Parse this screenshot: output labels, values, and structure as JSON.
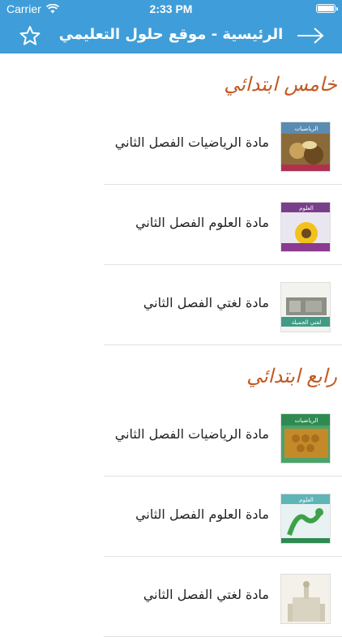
{
  "status_bar": {
    "carrier": "Carrier",
    "time": "2:33 PM"
  },
  "nav_bar": {
    "title": "الرئيسية - موقع حلول التعليمي"
  },
  "sections": [
    {
      "title": "خامس ابتدائي",
      "items": [
        {
          "label": "مادة الرياضيات الفصل الثاني",
          "thumb_text": "الرياضيات"
        },
        {
          "label": "مادة العلوم الفصل الثاني",
          "thumb_text": "العلوم"
        },
        {
          "label": "مادة لغتي الفصل الثاني",
          "thumb_text": "لغتي الجميلة"
        }
      ]
    },
    {
      "title": "رابع ابتدائي",
      "items": [
        {
          "label": "مادة الرياضيات الفصل الثاني",
          "thumb_text": "الرياضيات"
        },
        {
          "label": "مادة العلوم الفصل الثاني",
          "thumb_text": "العلوم"
        },
        {
          "label": "مادة لغتي الفصل الثاني",
          "thumb_text": ""
        }
      ]
    }
  ],
  "colors": {
    "nav": "#3f9ed9",
    "section_title": "#c25a23"
  }
}
